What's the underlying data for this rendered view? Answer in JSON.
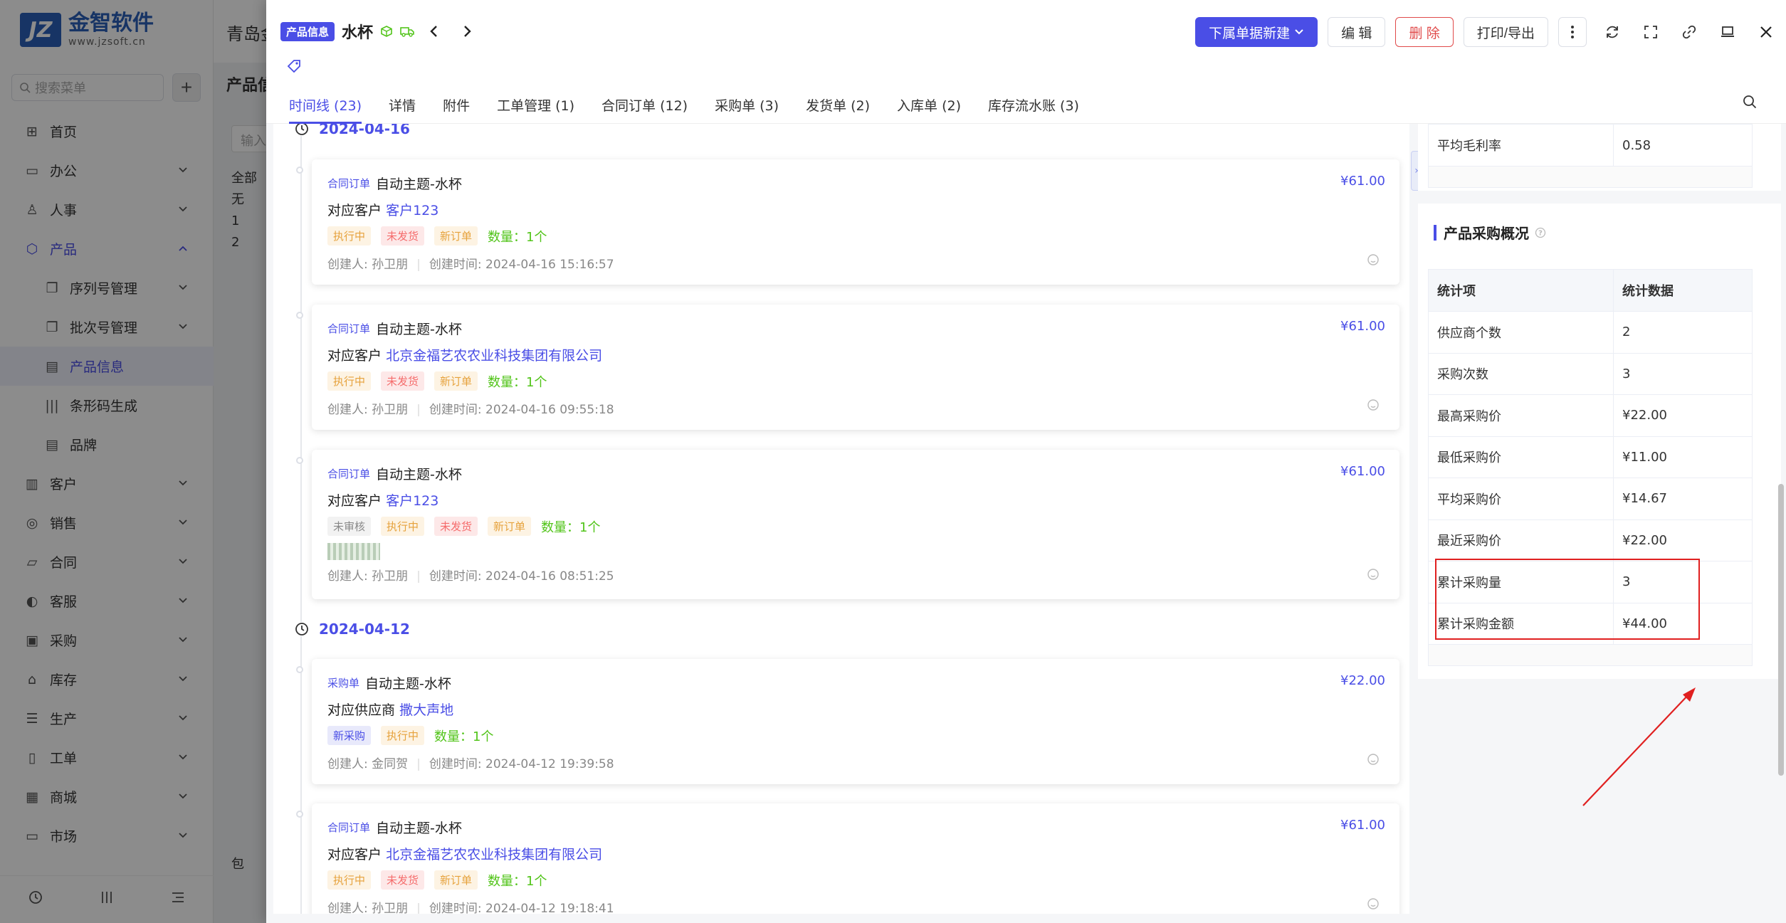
{
  "sidebar": {
    "logo_name": "金智软件",
    "logo_url": "www.jzsoft.cn",
    "search_placeholder": "搜索菜单",
    "items": [
      {
        "label": "首页",
        "icon": "home-icon"
      },
      {
        "label": "办公",
        "icon": "office-icon"
      },
      {
        "label": "人事",
        "icon": "hr-icon"
      },
      {
        "label": "产品",
        "icon": "product-icon"
      },
      {
        "label": "序列号管理",
        "icon": "serial-icon"
      },
      {
        "label": "批次号管理",
        "icon": "batch-icon"
      },
      {
        "label": "产品信息",
        "icon": "product-info-icon"
      },
      {
        "label": "条形码生成",
        "icon": "barcode-icon"
      },
      {
        "label": "品牌",
        "icon": "brand-icon"
      },
      {
        "label": "客户",
        "icon": "customer-icon"
      },
      {
        "label": "销售",
        "icon": "sales-icon"
      },
      {
        "label": "合同",
        "icon": "contract-icon"
      },
      {
        "label": "客服",
        "icon": "service-icon"
      },
      {
        "label": "采购",
        "icon": "purchase-icon"
      },
      {
        "label": "库存",
        "icon": "inventory-icon"
      },
      {
        "label": "生产",
        "icon": "production-icon"
      },
      {
        "label": "工单",
        "icon": "workorder-icon"
      },
      {
        "label": "商城",
        "icon": "mall-icon"
      },
      {
        "label": "市场",
        "icon": "market-icon"
      }
    ]
  },
  "background": {
    "company": "青岛金",
    "page_title": "产品信",
    "input_placeholder": "输入",
    "tree": [
      "全部",
      "无",
      "1",
      "2"
    ],
    "bottom_label": "包"
  },
  "drawer": {
    "badge": "产品信息",
    "title": "水杯",
    "actions": {
      "new_sub": "下属单据新建",
      "edit": "编 辑",
      "delete": "删 除",
      "print": "打印/导出"
    },
    "tabs": [
      "时间线 (23)",
      "详情",
      "附件",
      "工单管理 (1)",
      "合同订单 (12)",
      "采购单 (3)",
      "发货单 (2)",
      "入库单 (2)",
      "库存流水账 (3)"
    ]
  },
  "timeline": {
    "dates": [
      "2024-04-16",
      "2024-04-12"
    ],
    "cards": [
      {
        "type": "合同订单",
        "subject": "自动主题-水杯",
        "amount": "¥61.00",
        "party_label": "对应客户",
        "party": "客户123",
        "tags": [
          "执行中",
          "未发货",
          "新订单"
        ],
        "qty": "数量：1个",
        "creator": "创建人: 孙卫朋",
        "time": "创建时间: 2024-04-16 15:16:57"
      },
      {
        "type": "合同订单",
        "subject": "自动主题-水杯",
        "amount": "¥61.00",
        "party_label": "对应客户",
        "party": "北京金福艺农农业科技集团有限公司",
        "tags": [
          "执行中",
          "未发货",
          "新订单"
        ],
        "qty": "数量：1个",
        "creator": "创建人: 孙卫朋",
        "time": "创建时间: 2024-04-16 09:55:18"
      },
      {
        "type": "合同订单",
        "subject": "自动主题-水杯",
        "amount": "¥61.00",
        "party_label": "对应客户",
        "party": "客户123",
        "tags": [
          "未审核",
          "执行中",
          "未发货",
          "新订单"
        ],
        "qty": "数量：1个",
        "creator": "创建人: 孙卫朋",
        "time": "创建时间: 2024-04-16 08:51:25"
      },
      {
        "type": "采购单",
        "subject": "自动主题-水杯",
        "amount": "¥22.00",
        "party_label": "对应供应商",
        "party": "撒大声地",
        "tags": [
          "新采购",
          "执行中"
        ],
        "qty": "数量：1个",
        "creator": "创建人: 金同贺",
        "time": "创建时间: 2024-04-12 19:39:58"
      },
      {
        "type": "合同订单",
        "subject": "自动主题-水杯",
        "amount": "¥61.00",
        "party_label": "对应客户",
        "party": "北京金福艺农农业科技集团有限公司",
        "tags": [
          "执行中",
          "未发货",
          "新订单"
        ],
        "qty": "数量：1个",
        "creator": "创建人: 孙卫朋",
        "time": "创建时间: 2024-04-12 19:18:41"
      }
    ]
  },
  "panel": {
    "top_row": {
      "label": "平均毛利率",
      "value": "0.58"
    },
    "title": "产品采购概况",
    "headers": [
      "统计项",
      "统计数据"
    ],
    "rows": [
      {
        "label": "供应商个数",
        "value": "2"
      },
      {
        "label": "采购次数",
        "value": "3"
      },
      {
        "label": "最高采购价",
        "value": "¥22.00"
      },
      {
        "label": "最低采购价",
        "value": "¥11.00"
      },
      {
        "label": "平均采购价",
        "value": "¥14.67"
      },
      {
        "label": "最近采购价",
        "value": "¥22.00"
      },
      {
        "label": "累计采购量",
        "value": "3"
      },
      {
        "label": "累计采购金额",
        "value": "¥44.00"
      }
    ]
  },
  "colors": {
    "accent": "#4a4ee6",
    "danger": "#e04a4a",
    "highlight": "#e02020",
    "success": "#52c41a",
    "warning": "#e6a23c"
  }
}
